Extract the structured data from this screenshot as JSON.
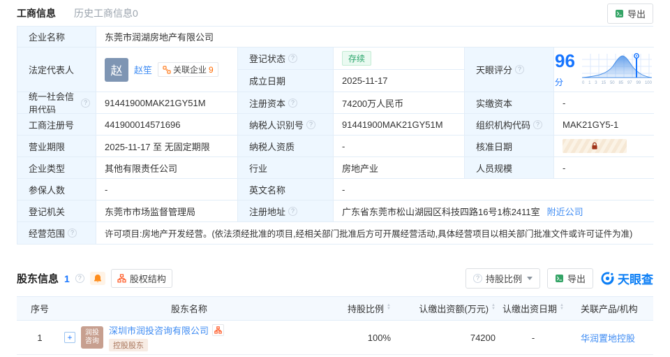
{
  "tabs": {
    "main": "工商信息",
    "history": "历史工商信息0"
  },
  "toolbar": {
    "export_label": "导出"
  },
  "company": {
    "name_label": "企业名称",
    "name": "东莞市润湖房地产有限公司",
    "legal_rep_label": "法定代表人",
    "legal_rep_avatar": "赵",
    "legal_rep": "赵笙",
    "related_label": "关联企业",
    "related_count": "9",
    "reg_status_label": "登记状态",
    "reg_status": "存续",
    "established_label": "成立日期",
    "established": "2025-11-17",
    "score_label": "天眼评分",
    "score": "96",
    "score_unit": "分",
    "uscc_label": "统一社会信用代码",
    "uscc": "91441900MAK21GY51M",
    "reg_capital_label": "注册资本",
    "reg_capital": "74200万人民币",
    "paid_capital_label": "实缴资本",
    "paid_capital": "-",
    "reg_no_label": "工商注册号",
    "reg_no": "441900014571696",
    "taxpayer_id_label": "纳税人识别号",
    "taxpayer_id": "91441900MAK21GY51M",
    "org_code_label": "组织机构代码",
    "org_code": "MAK21GY5-1",
    "term_label": "营业期限",
    "term": "2025-11-17 至 无固定期限",
    "taxpayer_qual_label": "纳税人资质",
    "taxpayer_qual": "-",
    "approval_date_label": "核准日期",
    "type_label": "企业类型",
    "type": "其他有限责任公司",
    "industry_label": "行业",
    "industry": "房地产业",
    "staff_label": "人员规模",
    "staff": "-",
    "insured_label": "参保人数",
    "insured": "-",
    "en_name_label": "英文名称",
    "en_name": "-",
    "authority_label": "登记机关",
    "authority": "东莞市市场监督管理局",
    "address_label": "注册地址",
    "address": "广东省东莞市松山湖园区科技四路16号1栋2411室",
    "nearby_label": "附近公司",
    "scope_label": "经营范围",
    "scope": "许可项目:房地产开发经营。(依法须经批准的项目,经相关部门批准后方可开展经营活动,具体经营项目以相关部门批准文件或许可证件为准)"
  },
  "chart_data": {
    "type": "area",
    "title": "天眼评分",
    "score": 96,
    "x_ticks": [
      "0",
      "1",
      "3",
      "15",
      "50",
      "85",
      "97",
      "99",
      "100"
    ],
    "marker_x": "97",
    "legend_position": "none",
    "grid": true
  },
  "shareholders": {
    "title": "股东信息",
    "count": "1",
    "structure_label": "股权结构",
    "ratio_filter_label": "持股比例",
    "export_label": "导出",
    "brand": "天眼查",
    "columns": {
      "index": "序号",
      "name": "股东名称",
      "ratio": "持股比例",
      "amount": "认缴出资额(万元)",
      "date": "认缴出资日期",
      "related": "关联产品/机构"
    },
    "rows": [
      {
        "index": "1",
        "logo_line1": "润投",
        "logo_line2": "咨询",
        "name": "深圳市润投咨询有限公司",
        "tag": "控股股东",
        "ratio": "100%",
        "amount": "74200",
        "date": "-",
        "related": "华润置地控股"
      }
    ]
  },
  "colors": {
    "accent_blue": "#1775ff",
    "link_blue": "#3f8cf3",
    "status_green": "#2aa56b",
    "icon_orange": "#ff7c1f",
    "label_bg": "#eef7ff",
    "lock_red": "#a03319",
    "logo_tan": "#c79f8f"
  }
}
